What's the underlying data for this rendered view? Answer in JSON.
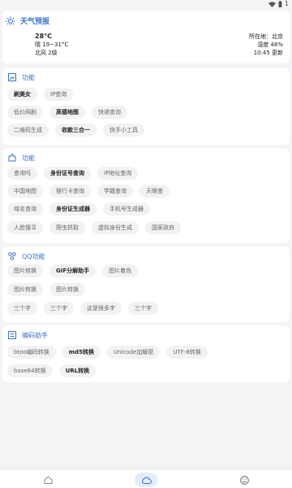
{
  "statusbar": {
    "battery": "1"
  },
  "weather": {
    "title": "天气预报",
    "temperature": "28°C",
    "condition": "晴 19~31°C",
    "wind": "北风 2级",
    "location": "所在地：北京",
    "humidity": "湿度 48%",
    "time": "10:45 更新"
  },
  "sections": [
    {
      "title": "功能",
      "rows": [
        [
          "刷美女",
          "IP查询"
        ],
        [
          "低价网剧",
          "高德地图",
          "快递查询"
        ],
        [
          "二维码生成",
          "收款三合一",
          "快手小工具"
        ]
      ],
      "bold": [
        "刷美女",
        "高德地图",
        "收款三合一"
      ]
    },
    {
      "title": "功能",
      "rows": [
        [
          "查询吗",
          "身份证号查询",
          "IP地址查询"
        ],
        [
          "中国地图",
          "银行卡查询",
          "学籍查询",
          "天眼查"
        ],
        [
          "域名查询",
          "身份证生成器",
          "手机号生成器"
        ],
        [
          "人脸搜寻",
          "爬虫抓取",
          "虚拟身份生成",
          "国家政府"
        ]
      ],
      "bold": [
        "身份证号查询",
        "身份证生成器"
      ]
    },
    {
      "title": "QQ功能",
      "rows": [
        [
          "图片转换",
          "GIF分解助手",
          "图片着色"
        ],
        [
          "图片转换",
          "图片转换"
        ],
        [
          "三个字",
          "三个字",
          "这是很多字",
          "三个字"
        ]
      ],
      "bold": [
        "GIF分解助手"
      ]
    },
    {
      "title": "编码助手",
      "rows": [
        [
          "btoo编码转换",
          "md5转换",
          "Unicode加解密",
          "UTF-8转换"
        ],
        [
          "base64转换",
          "URL转换"
        ]
      ],
      "bold": [
        "md5转换",
        "URL转换"
      ]
    }
  ],
  "nav": {
    "items": [
      "home-icon",
      "cloud-icon",
      "smile-icon"
    ],
    "active": "cloud-icon"
  },
  "colors": {
    "accent": "#3a72c9",
    "chip_bg": "#f2f2f4",
    "page_bg": "#f4f4f6"
  }
}
